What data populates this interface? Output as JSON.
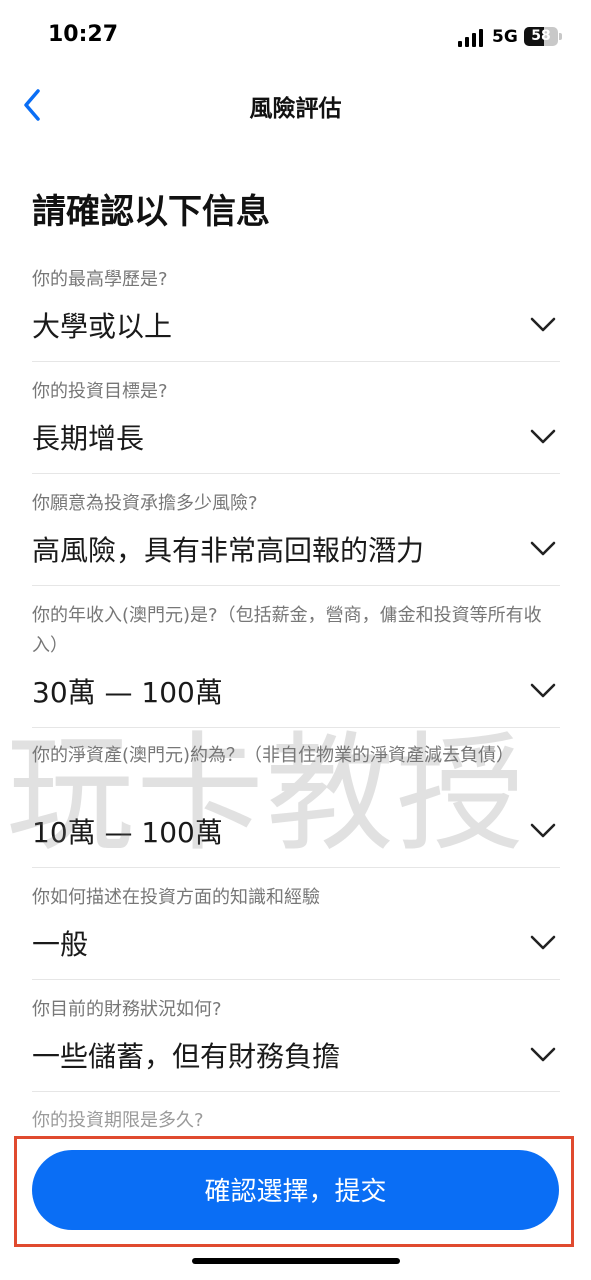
{
  "status_bar": {
    "time": "10:27",
    "network": "5G",
    "battery": "58",
    "battery_level": 0.58
  },
  "nav": {
    "title": "風險評估",
    "back_icon": "chevron-left-icon"
  },
  "page_title": "請確認以下信息",
  "fields": [
    {
      "question": "你的最高學歷是?",
      "answer": "大學或以上"
    },
    {
      "question": "你的投資目標是?",
      "answer": "長期增長"
    },
    {
      "question": "你願意為投資承擔多少風險?",
      "answer": "高風險，具有非常高回報的潛力"
    },
    {
      "question": "你的年收入(澳門元)是?（包括薪金，營商，傭金和投資等所有收入）",
      "answer": "30萬 — 100萬"
    },
    {
      "question": "你的淨資產(澳門元)約為？（非自住物業的淨資產減去負債）",
      "answer": "10萬 — 100萬"
    },
    {
      "question": "你如何描述在投資方面的知識和經驗",
      "answer": "一般"
    },
    {
      "question": "你目前的財務狀況如何?",
      "answer": "一些儲蓄，但有財務負擔"
    }
  ],
  "partial_question": "你的投資期限是多久?",
  "submit_label": "確認選擇，提交",
  "watermark": "玩卡教授",
  "colors": {
    "accent": "#0a6ef5",
    "highlight": "#e04a2f"
  }
}
